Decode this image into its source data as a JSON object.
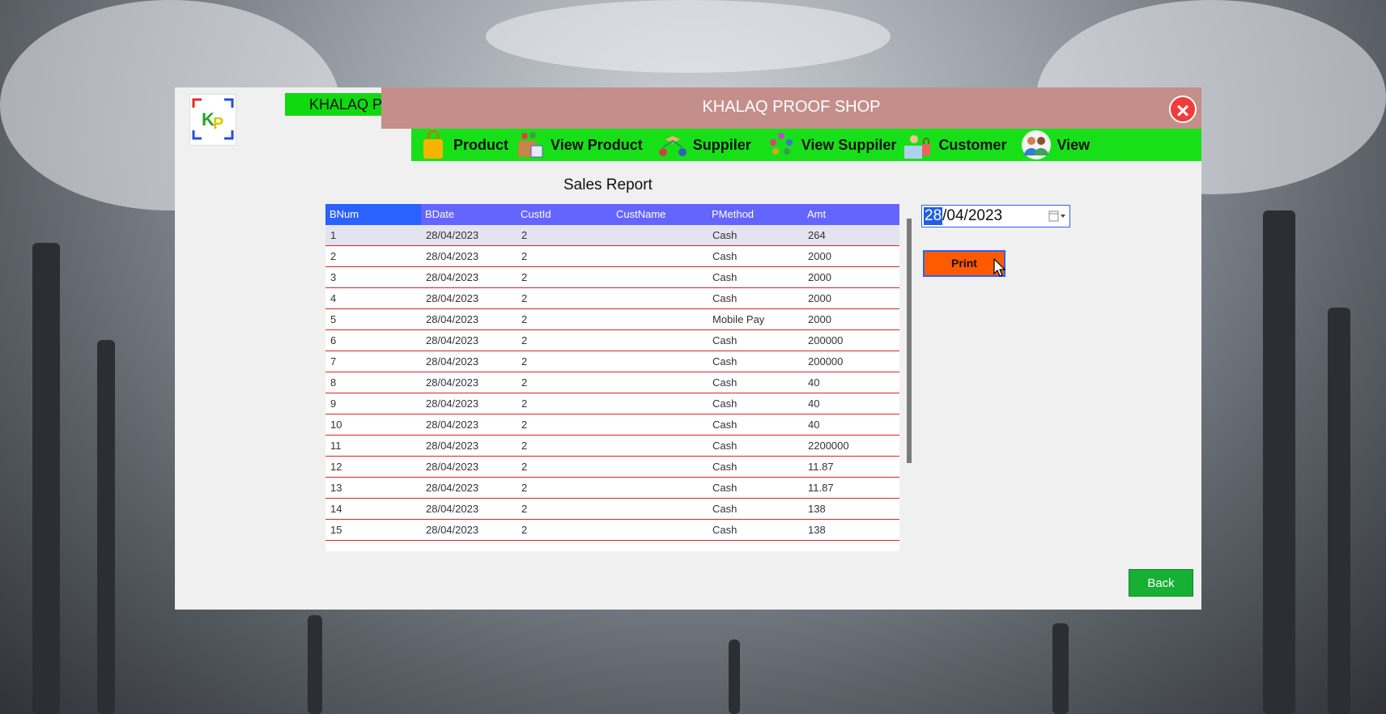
{
  "app": {
    "brand_tag": "KHALAQ PROOF",
    "title": "KHALAQ PROOF SHOP",
    "logo_text": "KP"
  },
  "nav": {
    "items": [
      {
        "label": "Product",
        "icon": "shopping-bag-icon"
      },
      {
        "label": "View Product",
        "icon": "product-box-icon"
      },
      {
        "label": "Suppiler",
        "icon": "handshake-icon"
      },
      {
        "label": "View Suppiler",
        "icon": "group-people-icon"
      },
      {
        "label": "Customer",
        "icon": "customer-shopper-icon"
      },
      {
        "label": "View",
        "icon": "users-pair-icon"
      }
    ]
  },
  "report": {
    "title": "Sales Report",
    "columns": [
      "BNum",
      "BDate",
      "CustId",
      "CustName",
      "PMethod",
      "Amt"
    ],
    "rows": [
      [
        "1",
        "28/04/2023",
        "2",
        "",
        "Cash",
        "264"
      ],
      [
        "2",
        "28/04/2023",
        "2",
        "",
        "Cash",
        "2000"
      ],
      [
        "3",
        "28/04/2023",
        "2",
        "",
        "Cash",
        "2000"
      ],
      [
        "4",
        "28/04/2023",
        "2",
        "",
        "Cash",
        "2000"
      ],
      [
        "5",
        "28/04/2023",
        "2",
        "",
        "Mobile Pay",
        "2000"
      ],
      [
        "6",
        "28/04/2023",
        "2",
        "",
        "Cash",
        "200000"
      ],
      [
        "7",
        "28/04/2023",
        "2",
        "",
        "Cash",
        "200000"
      ],
      [
        "8",
        "28/04/2023",
        "2",
        "",
        "Cash",
        "40"
      ],
      [
        "9",
        "28/04/2023",
        "2",
        "",
        "Cash",
        "40"
      ],
      [
        "10",
        "28/04/2023",
        "2",
        "",
        "Cash",
        "40"
      ],
      [
        "11",
        "28/04/2023",
        "2",
        "",
        "Cash",
        "2200000"
      ],
      [
        "12",
        "28/04/2023",
        "2",
        "",
        "Cash",
        "11.87"
      ],
      [
        "13",
        "28/04/2023",
        "2",
        "",
        "Cash",
        "11.87"
      ],
      [
        "14",
        "28/04/2023",
        "2",
        "",
        "Cash",
        "138"
      ],
      [
        "15",
        "28/04/2023",
        "2",
        "",
        "Cash",
        "138"
      ]
    ],
    "selected_row": 0
  },
  "date_picker": {
    "day": "28",
    "rest": "/04/2023"
  },
  "buttons": {
    "print": "Print",
    "back": "Back"
  },
  "colors": {
    "title_bar": "#c48f8b",
    "nav_bar": "#18e018",
    "grid_header": "#6464ff",
    "print_button": "#ff5a00",
    "back_button": "#17b034",
    "close_button": "#f03c3c"
  }
}
